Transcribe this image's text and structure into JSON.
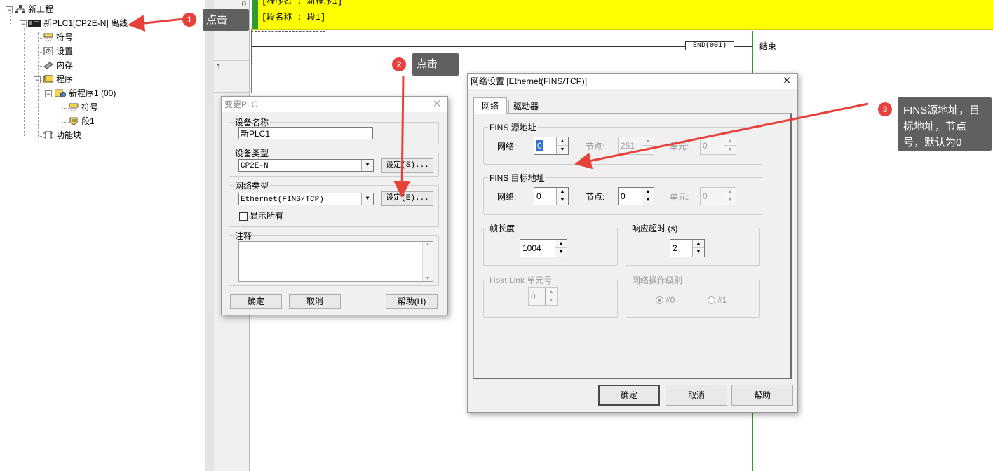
{
  "tree": {
    "root": "新工程",
    "plc": "新PLC1[CP2E-N] 离线",
    "symbols": "符号",
    "settings": "设置",
    "memory": "内存",
    "programs": "程序",
    "program1": "新程序1 (00)",
    "program1_symbols": "符号",
    "section1": "段1",
    "function_blocks": "功能块"
  },
  "ladder": {
    "rung0": "0",
    "rung1": "1",
    "program_name_line": "[程序名 : 新程序1]",
    "section_name_line": "[段名称 : 段1]",
    "end_instruction": "END(001)",
    "end_comment": "结束"
  },
  "change_plc": {
    "title": "变更PLC",
    "device_name_label": "设备名称",
    "device_name_value": "新PLC1",
    "device_type_label": "设备类型",
    "device_type_value": "CP2E-N",
    "device_type_settings": "设定(S)...",
    "network_type_label": "网络类型",
    "network_type_value": "Ethernet(FINS/TCP)",
    "network_type_settings": "设定(E)...",
    "show_all": "显示所有",
    "comment_label": "注释",
    "ok": "确定",
    "cancel": "取消",
    "help": "帮助(H)"
  },
  "network_settings": {
    "title": "网络设置 [Ethernet(FINS/TCP)]",
    "tab_network": "网络",
    "tab_driver": "驱动器",
    "fins_source_label": "FINS 源地址",
    "fins_dest_label": "FINS 目标地址",
    "network_label": "网络:",
    "node_label": "节点:",
    "unit_label": "单元:",
    "src_network": "0",
    "src_node": "251",
    "src_unit": "0",
    "dst_network": "0",
    "dst_node": "0",
    "dst_unit": "0",
    "frame_length_label": "帧长度",
    "frame_length": "1004",
    "response_timeout_label": "响应超时 (s)",
    "response_timeout": "2",
    "host_link_label": "Host Link 单元号",
    "host_link_value": "0",
    "network_level_label": "网络操作级别",
    "level0": "#0",
    "level1": "#1",
    "ok": "确定",
    "cancel": "取消",
    "help": "帮助"
  },
  "callouts": {
    "step1_num": "1",
    "step1_text": "点击",
    "step2_num": "2",
    "step2_text": "点击",
    "step3_num": "3",
    "step3_text": "FINS源地址，目标地址，节点号，默认为0"
  },
  "colors": {
    "annotation_red": "#e8403a",
    "tooltip_gray": "#606060",
    "section_header_yellow": "#ffff00",
    "power_rail_green": "#2e9b2e"
  }
}
